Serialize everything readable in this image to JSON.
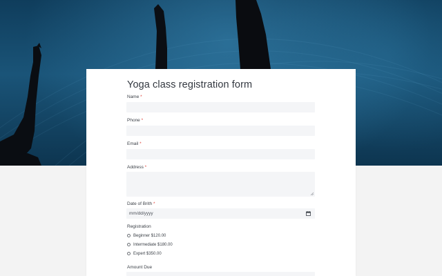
{
  "form": {
    "title": "Yoga class registration form",
    "required_mark": "*",
    "fields": {
      "name": {
        "label": "Name",
        "value": ""
      },
      "phone": {
        "label": "Phone",
        "value": ""
      },
      "email": {
        "label": "Email",
        "value": ""
      },
      "address": {
        "label": "Address",
        "value": ""
      },
      "dob": {
        "label": "Date of Brith",
        "value": "mm/dd/yyyy"
      }
    },
    "registration": {
      "label": "Registration",
      "options": [
        "Beginner $120.00",
        "Intermediate $180.00",
        "Expert $350.00"
      ]
    },
    "amount_due": {
      "label": "Amount Due"
    }
  },
  "icons": {
    "calendar": "calendar-icon"
  },
  "colors": {
    "required": "#e0463d",
    "input_bg": "#f4f5f7",
    "page_bg": "#f3f3f3"
  }
}
